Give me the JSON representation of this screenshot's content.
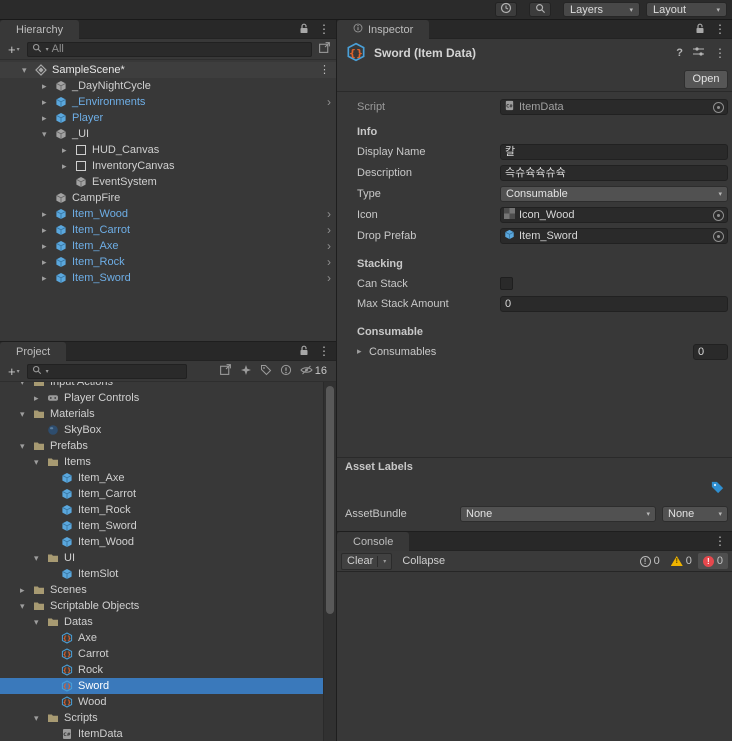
{
  "colors": {
    "selection": "#3a79bb",
    "prefab_text": "#6eaee6",
    "tag": "#2f8fd0",
    "warning": "#f0b400",
    "error": "#e5484d"
  },
  "topbar": {
    "layers_label": "Layers",
    "layout_label": "Layout"
  },
  "icons": {
    "foldout_open": "▾",
    "foldout_closed": "▸",
    "prefab_chevron": "›",
    "menu_dots": "⋮",
    "search": "magnifier",
    "lock": "padlock"
  },
  "hierarchy": {
    "tab_label": "Hierarchy",
    "create_label": "+",
    "search_text": "All",
    "rows": [
      {
        "label": "SampleScene*",
        "depth": 0,
        "arrow": "down",
        "icon": "scene",
        "scene": true,
        "menu": true
      },
      {
        "label": "_DayNightCycle",
        "depth": 1,
        "arrow": "right",
        "icon": "gameobject"
      },
      {
        "label": "_Environments",
        "depth": 1,
        "arrow": "right",
        "icon": "prefab",
        "prefab": true,
        "chevron": true
      },
      {
        "label": "Player",
        "depth": 1,
        "arrow": "right",
        "icon": "prefab",
        "prefab": true
      },
      {
        "label": "_UI",
        "depth": 1,
        "arrow": "down",
        "icon": "gameobject"
      },
      {
        "label": "HUD_Canvas",
        "depth": 2,
        "arrow": "right",
        "icon": "canvas"
      },
      {
        "label": "InventoryCanvas",
        "depth": 2,
        "arrow": "right",
        "icon": "canvas"
      },
      {
        "label": "EventSystem",
        "depth": 2,
        "arrow": "none",
        "icon": "gameobject"
      },
      {
        "label": "CampFire",
        "depth": 1,
        "arrow": "none",
        "icon": "gameobject"
      },
      {
        "label": "Item_Wood",
        "depth": 1,
        "arrow": "right",
        "icon": "prefab",
        "prefab": true,
        "chevron": true
      },
      {
        "label": "Item_Carrot",
        "depth": 1,
        "arrow": "right",
        "icon": "prefab",
        "prefab": true,
        "chevron": true
      },
      {
        "label": "Item_Axe",
        "depth": 1,
        "arrow": "right",
        "icon": "prefab",
        "prefab": true,
        "chevron": true
      },
      {
        "label": "Item_Rock",
        "depth": 1,
        "arrow": "right",
        "icon": "prefab",
        "prefab": true,
        "chevron": true
      },
      {
        "label": "Item_Sword",
        "depth": 1,
        "arrow": "right",
        "icon": "prefab",
        "prefab": true,
        "chevron": true
      }
    ]
  },
  "project": {
    "tab_label": "Project",
    "create_label": "+",
    "hidden_count": "16",
    "rows": [
      {
        "label": "Input Actions",
        "depth": 0,
        "arrow": "down",
        "icon": "folder"
      },
      {
        "label": "Player Controls",
        "depth": 1,
        "arrow": "right",
        "icon": "input"
      },
      {
        "label": "Materials",
        "depth": 0,
        "arrow": "down",
        "icon": "folder"
      },
      {
        "label": "SkyBox",
        "depth": 1,
        "arrow": "none",
        "icon": "material"
      },
      {
        "label": "Prefabs",
        "depth": 0,
        "arrow": "down",
        "icon": "folder"
      },
      {
        "label": "Items",
        "depth": 1,
        "arrow": "down",
        "icon": "folder"
      },
      {
        "label": "Item_Axe",
        "depth": 2,
        "arrow": "none",
        "icon": "prefab"
      },
      {
        "label": "Item_Carrot",
        "depth": 2,
        "arrow": "none",
        "icon": "prefab"
      },
      {
        "label": "Item_Rock",
        "depth": 2,
        "arrow": "none",
        "icon": "prefab"
      },
      {
        "label": "Item_Sword",
        "depth": 2,
        "arrow": "none",
        "icon": "prefab"
      },
      {
        "label": "Item_Wood",
        "depth": 2,
        "arrow": "none",
        "icon": "prefab"
      },
      {
        "label": "UI",
        "depth": 1,
        "arrow": "down",
        "icon": "folder"
      },
      {
        "label": "ItemSlot",
        "depth": 2,
        "arrow": "none",
        "icon": "prefab"
      },
      {
        "label": "Scenes",
        "depth": 0,
        "arrow": "right",
        "icon": "folder"
      },
      {
        "label": "Scriptable Objects",
        "depth": 0,
        "arrow": "down",
        "icon": "folder"
      },
      {
        "label": "Datas",
        "depth": 1,
        "arrow": "down",
        "icon": "folder"
      },
      {
        "label": "Axe",
        "depth": 2,
        "arrow": "none",
        "icon": "itemdata"
      },
      {
        "label": "Carrot",
        "depth": 2,
        "arrow": "none",
        "icon": "itemdata"
      },
      {
        "label": "Rock",
        "depth": 2,
        "arrow": "none",
        "icon": "itemdata"
      },
      {
        "label": "Sword",
        "depth": 2,
        "arrow": "none",
        "icon": "itemdata",
        "selected": true
      },
      {
        "label": "Wood",
        "depth": 2,
        "arrow": "none",
        "icon": "itemdata"
      },
      {
        "label": "Scripts",
        "depth": 1,
        "arrow": "down",
        "icon": "folder"
      },
      {
        "label": "ItemData",
        "depth": 2,
        "arrow": "none",
        "icon": "script"
      }
    ]
  },
  "inspector": {
    "tab_label": "Inspector",
    "title": "Sword (Item Data)",
    "open_button_label": "Open",
    "script": {
      "label": "Script",
      "value": "ItemData"
    },
    "info_header": "Info",
    "display_name": {
      "label": "Display Name",
      "value": "칼"
    },
    "description": {
      "label": "Description",
      "value": "슥슈슉슉슈슉"
    },
    "type": {
      "label": "Type",
      "value": "Consumable"
    },
    "icon_field": {
      "label": "Icon",
      "value": "Icon_Wood"
    },
    "drop_prefab": {
      "label": "Drop Prefab",
      "value": "Item_Sword"
    },
    "stacking_header": "Stacking",
    "can_stack": {
      "label": "Can Stack",
      "checked": false
    },
    "max_stack": {
      "label": "Max Stack Amount",
      "value": "0"
    },
    "consumable_header": "Consumable",
    "consumables": {
      "label": "Consumables",
      "size": "0"
    },
    "asset_labels": {
      "header": "Asset Labels",
      "assetbundle_label": "AssetBundle",
      "bundle": "None",
      "variant": "None"
    }
  },
  "console": {
    "tab_label": "Console",
    "clear_label": "Clear",
    "collapse_label": "Collapse",
    "counts": {
      "info": "0",
      "warning": "0",
      "error": "0"
    }
  }
}
